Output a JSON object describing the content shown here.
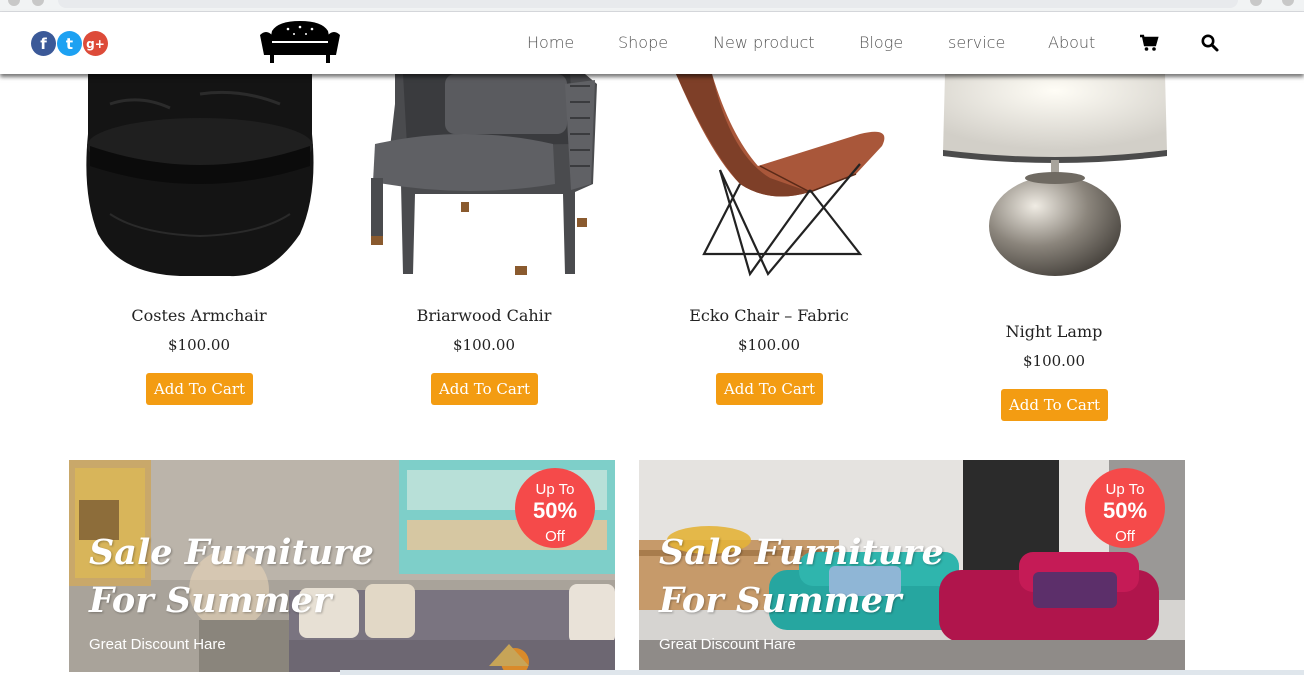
{
  "nav": {
    "social": [
      {
        "name": "facebook",
        "glyph": "f",
        "color": "#3b5998"
      },
      {
        "name": "twitter",
        "glyph": "t",
        "color": "#1da1f2"
      },
      {
        "name": "google-plus",
        "glyph": "g+",
        "color": "#dd4b39"
      }
    ],
    "logo_icon": "sofa-icon",
    "links": [
      "Home",
      "Shope",
      "New product",
      "Bloge",
      "service",
      "About"
    ],
    "cart_icon": "cart-icon",
    "search_icon": "search-icon"
  },
  "products": [
    {
      "name": "Costes Armchair",
      "price": "$100.00",
      "button": "Add To Cart",
      "image_icon": "black-leather-armchair"
    },
    {
      "name": "Briarwood Cahir",
      "price": "$100.00",
      "button": "Add To Cart",
      "image_icon": "grey-rope-armchair"
    },
    {
      "name": "Ecko Chair – Fabric",
      "price": "$100.00",
      "button": "Add To Cart",
      "image_icon": "butterfly-chair"
    },
    {
      "name": "Night Lamp",
      "price": "$100.00",
      "button": "Add To Cart",
      "image_icon": "chrome-table-lamp"
    }
  ],
  "banners": [
    {
      "badge_top": "Up To",
      "badge_value": "50%",
      "badge_bottom": "Off",
      "title_line1": "Sale Furniture",
      "title_line2": "For Summer",
      "subtitle": "Great Discount Hare"
    },
    {
      "badge_top": "Up To",
      "badge_value": "50%",
      "badge_bottom": "Off",
      "title_line1": "Sale Furniture",
      "title_line2": "For Summer",
      "subtitle": "Great Discount Hare"
    }
  ],
  "colors": {
    "accent": "#f39c12",
    "badge": "#f54a4a",
    "text": "#222222",
    "nav_text": "#555555"
  }
}
